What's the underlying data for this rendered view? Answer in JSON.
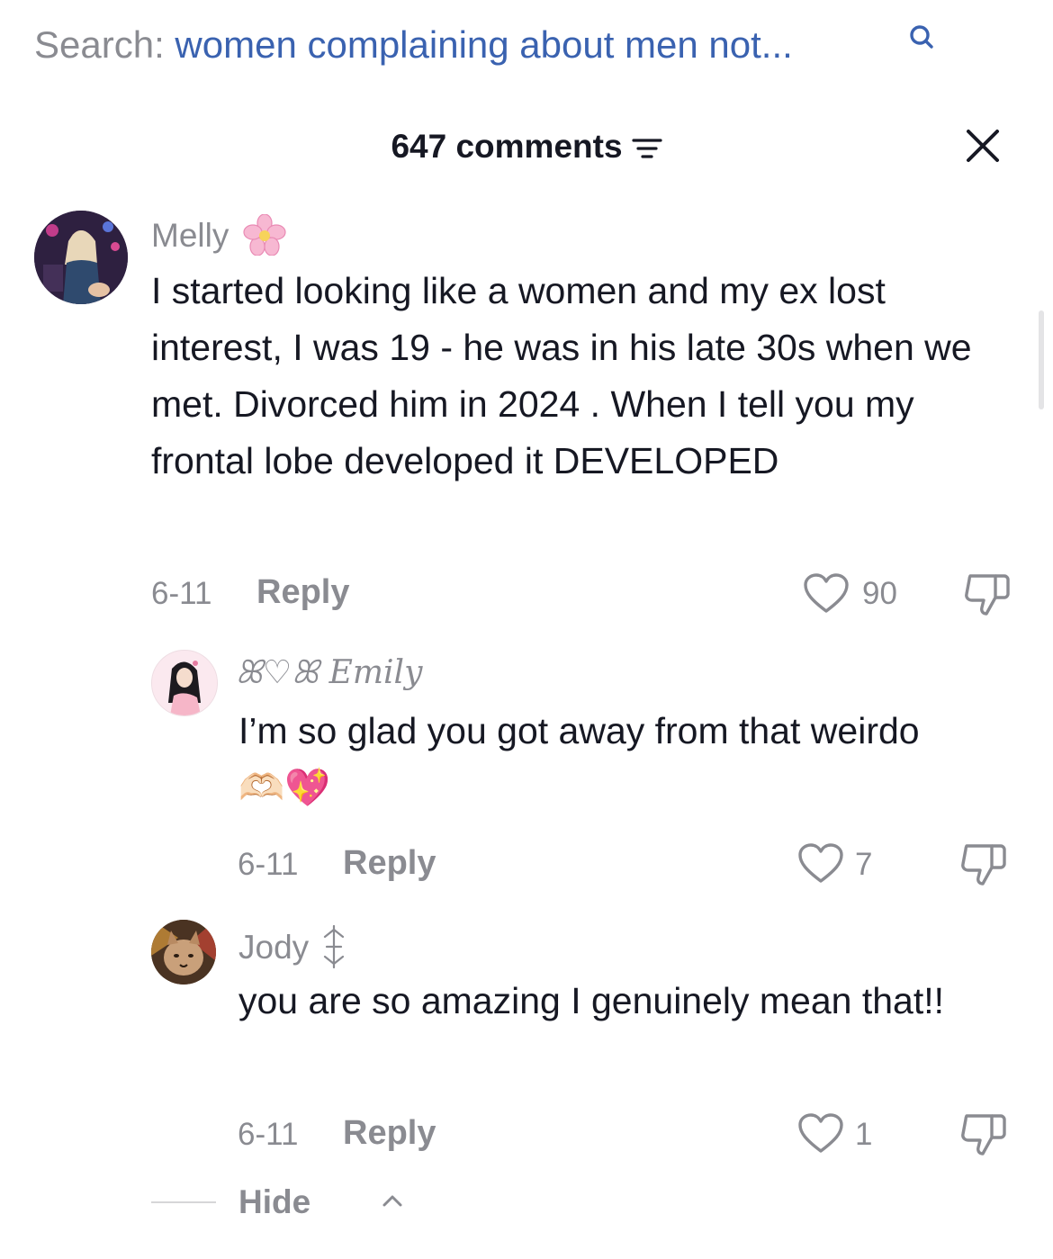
{
  "search": {
    "label": "Search:",
    "query": "women complaining about men not..."
  },
  "header": {
    "count_label": "647 comments"
  },
  "comments": [
    {
      "username": "Melly",
      "badge_emoji": "🌸",
      "text": "I started looking like a women and my ex lost interest, I was 19 - he was in his late 30s when we met. Divorced him in 2024 . When I tell you my frontal lobe developed it DEVELOPED",
      "date": "6-11",
      "reply_label": "Reply",
      "likes": "90"
    }
  ],
  "replies": [
    {
      "username": "ꕤ♡ꕤ Emily",
      "text": "I’m so glad you got away from that weirdo 🫶🏻💖",
      "date": "6-11",
      "reply_label": "Reply",
      "likes": "7"
    },
    {
      "username": "Jody",
      "badge": "✧",
      "text": "you are so amazing I genuinely mean that!!",
      "date": "6-11",
      "reply_label": "Reply",
      "likes": "1"
    }
  ],
  "hide_label": "Hide",
  "colors": {
    "query": "#3a62b0",
    "muted": "#8a8b91",
    "text": "#161823"
  }
}
